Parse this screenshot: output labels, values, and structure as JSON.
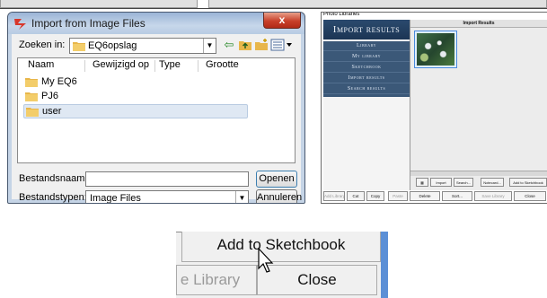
{
  "dialog": {
    "title": "Import from Image Files",
    "close_glyph": "x",
    "look_in_label": "Zoeken in:",
    "look_in_value": "EQ6opslag",
    "columns": [
      "Naam",
      "Gewijzigd op",
      "Type",
      "Grootte"
    ],
    "files": [
      {
        "name": "My EQ6",
        "selected": false
      },
      {
        "name": "PJ6",
        "selected": false
      },
      {
        "name": "user",
        "selected": true
      }
    ],
    "filename_label": "Bestandsnaam:",
    "filename_value": "",
    "filetype_label": "Bestandstypen:",
    "filetype_value": "Image Files",
    "open_label": "Openen",
    "cancel_label": "Annuleren"
  },
  "photo_library": {
    "window_title": "Photo Libraries",
    "header": "Import results",
    "menu": [
      "Library",
      "My library",
      "Sketchbook",
      "Import results",
      "Search results"
    ],
    "main_header": "Import Results",
    "toolbar": [
      "Import",
      "Search...",
      "Notecard...",
      "Add to Sketchbook"
    ],
    "bottom_bar": [
      {
        "label": "Add Library",
        "disabled": true
      },
      {
        "label": "Cut",
        "disabled": false
      },
      {
        "label": "Copy",
        "disabled": false
      },
      {
        "label": "Paste",
        "disabled": true
      },
      {
        "label": "Delete",
        "disabled": false
      },
      {
        "label": "Sort...",
        "disabled": false
      },
      {
        "label": "Save Library",
        "disabled": true
      },
      {
        "label": "Close",
        "disabled": false
      }
    ]
  },
  "zoom": {
    "add_label": "Add to Sketchbook",
    "library_label": "e Library",
    "close_label": "Close"
  },
  "colors": {
    "title_accent": "#c8402a",
    "library_header": "#1c3554",
    "library_menu": "#3b5878",
    "selection": "#dfe8f3"
  }
}
